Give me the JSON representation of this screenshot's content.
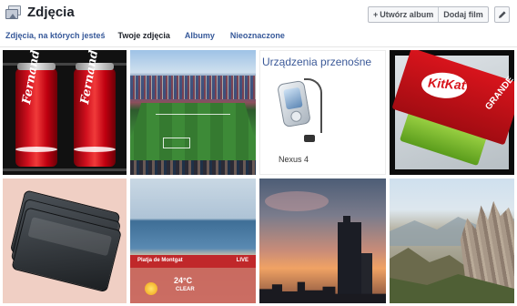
{
  "header": {
    "title": "Zdjęcia",
    "icon": "photos-icon",
    "create_album_label": "Utwórz album",
    "create_album_prefix": "+",
    "add_video_label": "Dodaj film",
    "edit_icon": "pencil-icon"
  },
  "tabs": [
    {
      "label": "Zdjęcia, na których jesteś",
      "active": false
    },
    {
      "label": "Twoje zdjęcia",
      "active": true
    },
    {
      "label": "Albumy",
      "active": false
    },
    {
      "label": "Nieoznaczone",
      "active": false
    }
  ],
  "photos": [
    {
      "subject": "coke-cans",
      "texts": [
        "Fernando",
        "Fernando"
      ]
    },
    {
      "subject": "stadium"
    },
    {
      "subject": "nexus",
      "texts": [
        "Urządzenia przenośne",
        "Nexus 4"
      ]
    },
    {
      "subject": "kitkat",
      "texts": [
        "KitKat",
        "GRANDE"
      ]
    },
    {
      "subject": "cards"
    },
    {
      "subject": "weather",
      "texts": [
        "Platja de Montgat",
        "LIVE",
        "24°C",
        "CLEAR"
      ]
    },
    {
      "subject": "sunset"
    },
    {
      "subject": "mountains"
    }
  ],
  "colors": {
    "link": "#365899",
    "active_tab": "#1d2129"
  }
}
